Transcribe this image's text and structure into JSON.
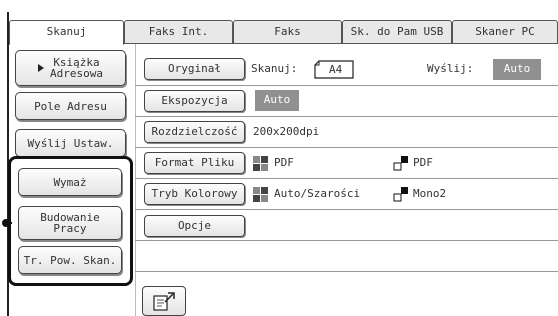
{
  "tabs": [
    {
      "label": "Skanuj",
      "active": true
    },
    {
      "label": "Faks Int.",
      "active": false
    },
    {
      "label": "Faks",
      "active": false
    },
    {
      "label": "Sk. do Pam USB",
      "active": false
    },
    {
      "label": "Skaner PC",
      "active": false
    }
  ],
  "sidebar": {
    "address_book": "Książka\nAdresowa",
    "address_field": "Pole Adresu",
    "send_settings": "Wyślij Ustaw.",
    "erase": "Wymaż",
    "job_build": "Budowanie\nPracy",
    "preview_scan": "Tr. Pow. Skan."
  },
  "settings": {
    "original": {
      "button": "Oryginał",
      "scan_label": "Skanuj:",
      "paper": "A4",
      "send_label": "Wyślij:",
      "send_value": "Auto"
    },
    "exposure": {
      "button": "Ekspozycja",
      "value": "Auto"
    },
    "resolution": {
      "button": "Rozdzielczość",
      "value": "200x200dpi"
    },
    "file_format": {
      "button": "Format Pliku",
      "value1": "PDF",
      "value2": "PDF"
    },
    "color_mode": {
      "button": "Tryb Kolorowy",
      "value1": "Auto/Szarości",
      "value2": "Mono2"
    },
    "options": {
      "button": "Opcje"
    }
  },
  "colors": {
    "accent_gray": "#909090",
    "highlight_border": "#111111"
  },
  "icons": {
    "paper": "paper-a4-icon",
    "color": "color-grid-icon",
    "mono": "mono-stair-icon",
    "preview": "scan-preview-icon",
    "arrow": "triangle-right-icon"
  }
}
